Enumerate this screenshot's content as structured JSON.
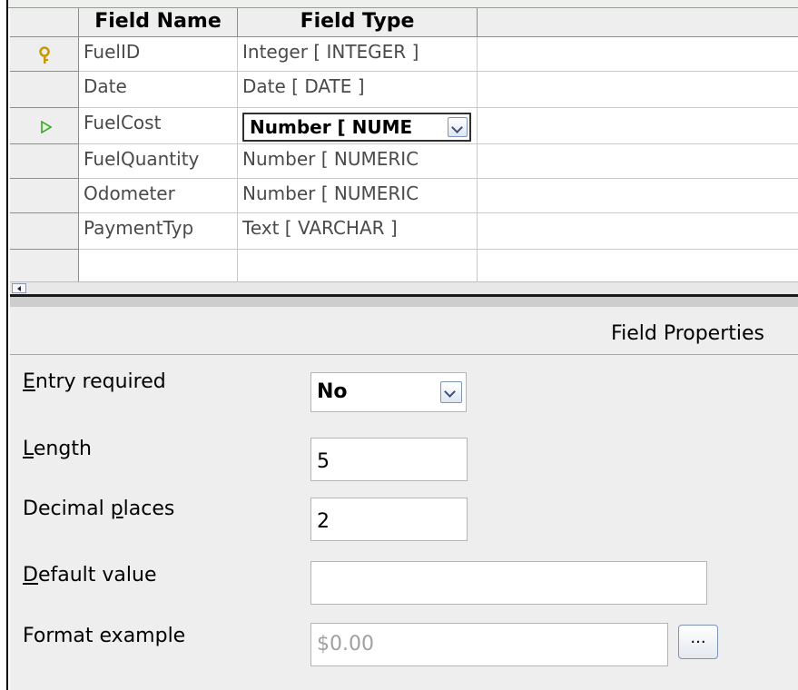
{
  "grid": {
    "columns": [
      "Field Name",
      "Field Type"
    ],
    "rows": [
      {
        "field_name": "FuelID",
        "field_type": "Integer [ INTEGER ]",
        "row_marker": "primary-key"
      },
      {
        "field_name": "Date",
        "field_type": "Date [ DATE ]",
        "row_marker": ""
      },
      {
        "field_name": "FuelCost",
        "field_type": "Number [ NUME",
        "row_marker": "current-row"
      },
      {
        "field_name": "FuelQuantity",
        "field_type": "Number [ NUMERIC",
        "row_marker": ""
      },
      {
        "field_name": "Odometer",
        "field_type": "Number [ NUMERIC",
        "row_marker": ""
      },
      {
        "field_name": "PaymentTyp",
        "field_type": "Text [ VARCHAR ]",
        "row_marker": ""
      },
      {
        "field_name": "",
        "field_type": "",
        "row_marker": ""
      }
    ]
  },
  "properties": {
    "title": "Field Properties",
    "entry_required": {
      "label_mnemonic": "E",
      "label_rest": "ntry required",
      "value": "No"
    },
    "length": {
      "label_mnemonic": "L",
      "label_rest": "ength",
      "value": "5"
    },
    "decimal_places": {
      "label_before": "Decimal ",
      "label_mnemonic": "p",
      "label_rest": "laces",
      "value": "2"
    },
    "default_value": {
      "label_mnemonic": "D",
      "label_rest": "efault value",
      "value": ""
    },
    "format_example": {
      "label": "Format example",
      "value": "$0.00",
      "button_label": "..."
    }
  },
  "colors": {
    "key_icon": "#c89a00",
    "arrow_icon": "#3aa52a",
    "disabled_text": "#a0a0a0"
  }
}
